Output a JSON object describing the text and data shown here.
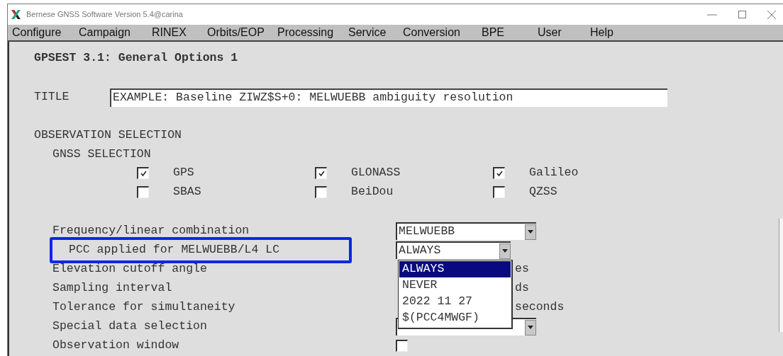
{
  "window": {
    "title": "Bernese GNSS Software Version 5.4@carina"
  },
  "menu": [
    {
      "label": "Configure"
    },
    {
      "label": "Campaign"
    },
    {
      "label": "RINEX"
    },
    {
      "label": "Orbits/EOP"
    },
    {
      "label": "Processing"
    },
    {
      "label": "Service"
    },
    {
      "label": "Conversion"
    },
    {
      "label": "BPE"
    },
    {
      "label": "User"
    },
    {
      "label": "Help"
    }
  ],
  "panel_title": "GPSEST 3.1: General Options 1",
  "title_field": {
    "label": "TITLE",
    "value": "EXAMPLE: Baseline ZIWZ$S+0: MELWUEBB ambiguity resolution"
  },
  "section": "OBSERVATION SELECTION",
  "subsection": "GNSS SELECTION",
  "gnss": [
    {
      "label": "GPS",
      "checked": true
    },
    {
      "label": "GLONASS",
      "checked": true
    },
    {
      "label": "Galileo",
      "checked": true
    },
    {
      "label": "SBAS",
      "checked": false
    },
    {
      "label": "BeiDou",
      "checked": false
    },
    {
      "label": "QZSS",
      "checked": false
    }
  ],
  "options": [
    {
      "label": "Frequency/linear combination",
      "kind": "dropdown",
      "value": "MELWUEBB",
      "highlighted": false,
      "indented": false,
      "open": false
    },
    {
      "label": "PCC applied for MELWUEBB/L4 LC",
      "kind": "dropdown",
      "value": "ALWAYS",
      "highlighted": true,
      "indented": true,
      "open": true
    },
    {
      "label": "Elevation cutoff angle",
      "kind": "unit",
      "unit": "es",
      "highlighted": false,
      "indented": false
    },
    {
      "label": "Sampling interval",
      "kind": "unit",
      "unit": "ds",
      "highlighted": false,
      "indented": false
    },
    {
      "label": "Tolerance for simultaneity",
      "kind": "unit",
      "unit": "seconds",
      "highlighted": false,
      "indented": false
    },
    {
      "label": "Special data selection",
      "kind": "dropdown",
      "highlighted": false,
      "indented": false,
      "open": false
    },
    {
      "label": "Observation window",
      "kind": "checkbox",
      "checked": false,
      "highlighted": false,
      "indented": false
    }
  ],
  "dropdown_list": [
    {
      "label": "ALWAYS",
      "selected": true
    },
    {
      "label": "NEVER",
      "selected": false
    },
    {
      "label": "2022 11 27",
      "selected": false
    },
    {
      "label": "$(PCC4MWGF)",
      "selected": false
    }
  ]
}
